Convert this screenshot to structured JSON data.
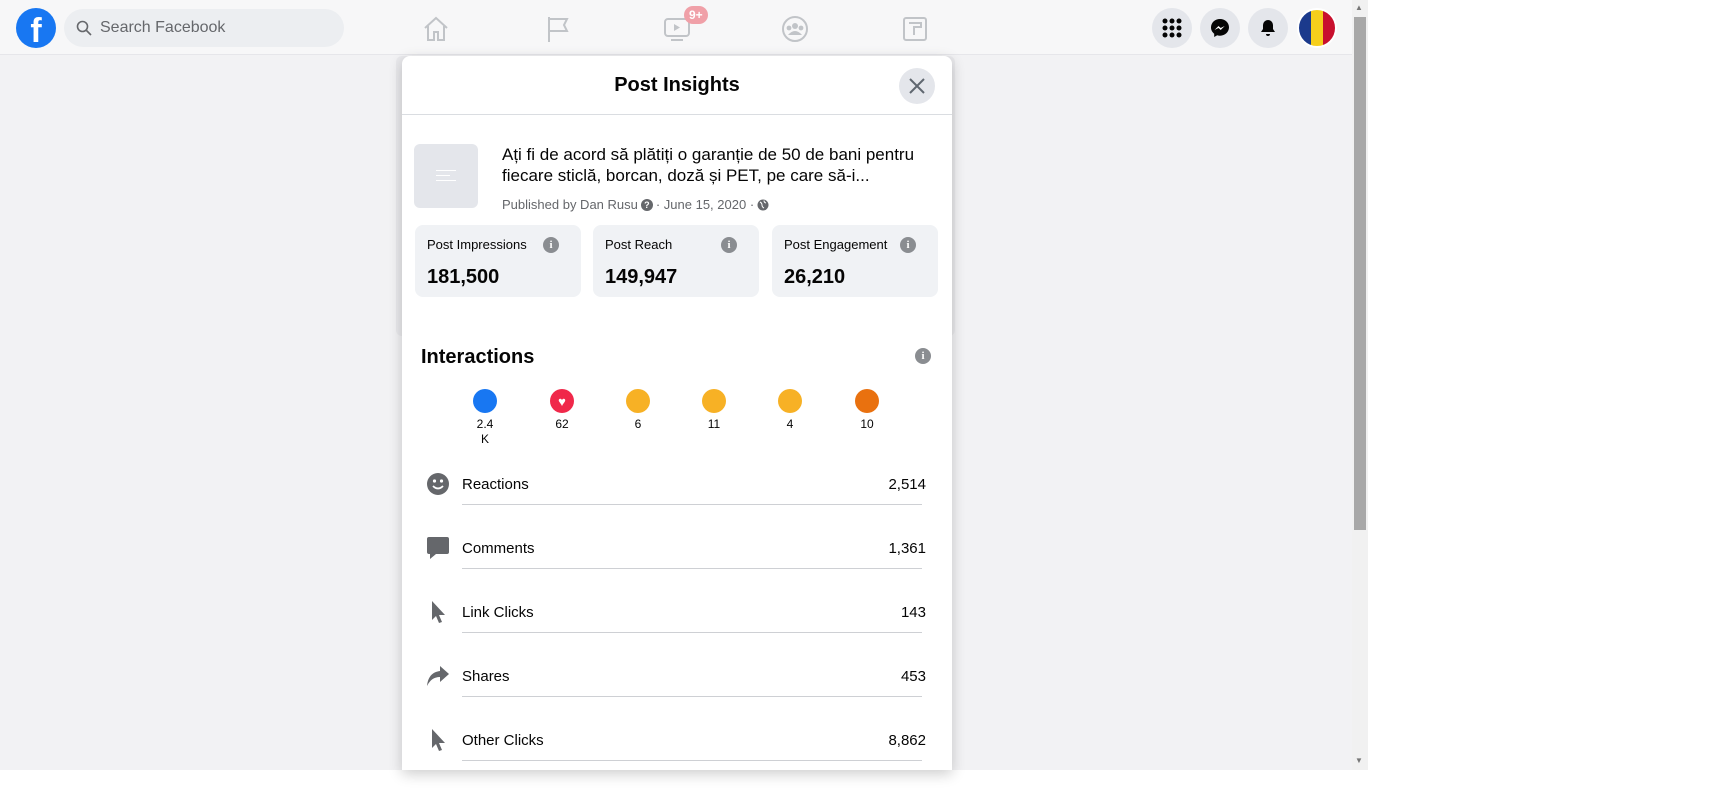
{
  "topbar": {
    "logo": "f",
    "search_placeholder": "Search Facebook",
    "video_badge": "9+",
    "nav_icons": [
      "home-icon",
      "flag-icon",
      "video-icon",
      "groups-icon",
      "gaming-icon"
    ],
    "right_icons": [
      "menu-grid-icon",
      "messenger-icon",
      "notifications-bell-icon",
      "profile-avatar"
    ]
  },
  "modal": {
    "title": "Post Insights",
    "post": {
      "title": "Ați fi de acord să plătiți o garanție de 50 de bani pentru fiecare sticlă, borcan, doză și PET, pe care să-i...",
      "published_by": "Published by Dan Rusu",
      "date": "· June 15, 2020 ·"
    },
    "stats": [
      {
        "label": "Post Impressions",
        "value": "181,500"
      },
      {
        "label": "Post Reach",
        "value": "149,947"
      },
      {
        "label": "Post Engagement",
        "value": "26,210"
      }
    ],
    "interactions": {
      "heading": "Interactions",
      "reactions": [
        {
          "icon": "like-icon",
          "count": "2.4 K",
          "color": "#1877f2"
        },
        {
          "icon": "love-icon",
          "count": "62",
          "color": "#f0284a"
        },
        {
          "icon": "haha-icon",
          "count": "6",
          "color": "#f7b125"
        },
        {
          "icon": "wow-icon",
          "count": "11",
          "color": "#f7b125"
        },
        {
          "icon": "sad-icon",
          "count": "4",
          "color": "#f7b125"
        },
        {
          "icon": "angry-icon",
          "count": "10",
          "color": "#e9710f"
        }
      ],
      "rows": [
        {
          "icon": "smiley-icon",
          "label": "Reactions",
          "value": "2,514"
        },
        {
          "icon": "comment-icon",
          "label": "Comments",
          "value": "1,361"
        },
        {
          "icon": "cursor-icon",
          "label": "Link Clicks",
          "value": "143"
        },
        {
          "icon": "share-icon",
          "label": "Shares",
          "value": "453"
        },
        {
          "icon": "cursor-icon",
          "label": "Other Clicks",
          "value": "8,862"
        }
      ]
    }
  }
}
